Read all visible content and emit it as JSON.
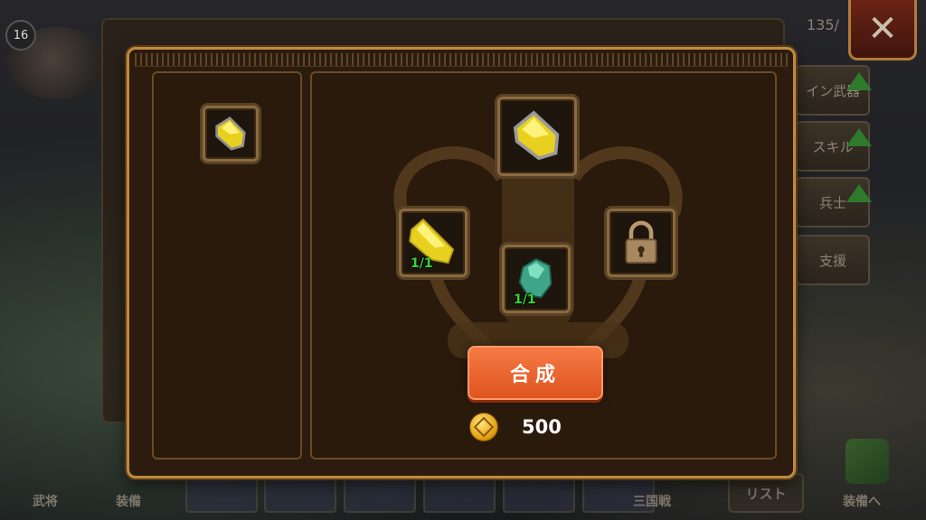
{
  "background": {
    "level": "16",
    "resource_value": "135/",
    "bottom_labels": [
      "武将",
      "装備",
      "三国戦",
      "装備へ"
    ],
    "list_button": "リスト"
  },
  "side_tabs": [
    {
      "label": "イン武器",
      "has_arrow": true
    },
    {
      "label": "スキル",
      "has_arrow": true
    },
    {
      "label": "兵士",
      "has_arrow": true
    },
    {
      "label": "支援",
      "has_arrow": false
    }
  ],
  "dialog": {
    "left_item": {
      "icon": "yellow-crystal-icon"
    },
    "target_item": {
      "icon": "yellow-crystal-icon"
    },
    "materials": [
      {
        "icon": "yellow-crystal-icon",
        "count": "1/1"
      },
      {
        "icon": "green-ore-icon",
        "count": "1/1"
      },
      {
        "icon": "lock-icon",
        "count": ""
      }
    ],
    "combine_label": "合成",
    "cost": {
      "icon": "gold-coin-icon",
      "value": "500"
    }
  },
  "colors": {
    "panel_border": "#c08a3e",
    "panel_bg": "#2a1a0c",
    "button": "#ef6a32",
    "count_text": "#36d63a"
  }
}
